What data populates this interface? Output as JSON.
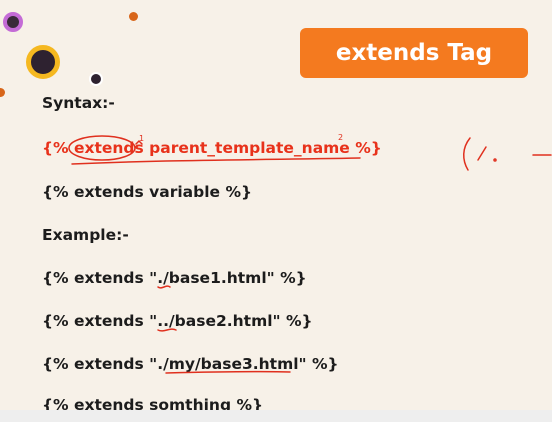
{
  "slide": {
    "title": "extends Tag",
    "accent_color": "#f47a1f",
    "text_color": "#1c1c1c",
    "highlight_color": "#e8321b",
    "lines": [
      {
        "text": "Syntax:-"
      },
      {
        "text": "{% extends parent_template_name %}"
      },
      {
        "text": "{% extends variable %}"
      },
      {
        "text": "Example:-"
      },
      {
        "text": "{% extends \"./base1.html\" %}"
      },
      {
        "text": "{% extends \"../base2.html\" %}"
      },
      {
        "text": "{% extends \"./my/base3.html\" %}"
      },
      {
        "text": "{% extends somthing %}"
      }
    ],
    "handwritten_marks": [
      "1",
      "2"
    ]
  }
}
